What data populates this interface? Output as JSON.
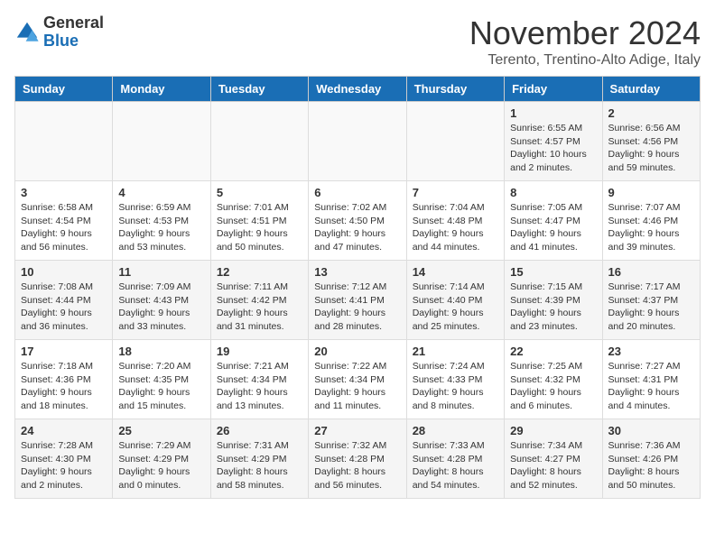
{
  "logo": {
    "general": "General",
    "blue": "Blue"
  },
  "title": "November 2024",
  "subtitle": "Terento, Trentino-Alto Adige, Italy",
  "headers": [
    "Sunday",
    "Monday",
    "Tuesday",
    "Wednesday",
    "Thursday",
    "Friday",
    "Saturday"
  ],
  "weeks": [
    [
      {
        "day": "",
        "info": ""
      },
      {
        "day": "",
        "info": ""
      },
      {
        "day": "",
        "info": ""
      },
      {
        "day": "",
        "info": ""
      },
      {
        "day": "",
        "info": ""
      },
      {
        "day": "1",
        "info": "Sunrise: 6:55 AM\nSunset: 4:57 PM\nDaylight: 10 hours and 2 minutes."
      },
      {
        "day": "2",
        "info": "Sunrise: 6:56 AM\nSunset: 4:56 PM\nDaylight: 9 hours and 59 minutes."
      }
    ],
    [
      {
        "day": "3",
        "info": "Sunrise: 6:58 AM\nSunset: 4:54 PM\nDaylight: 9 hours and 56 minutes."
      },
      {
        "day": "4",
        "info": "Sunrise: 6:59 AM\nSunset: 4:53 PM\nDaylight: 9 hours and 53 minutes."
      },
      {
        "day": "5",
        "info": "Sunrise: 7:01 AM\nSunset: 4:51 PM\nDaylight: 9 hours and 50 minutes."
      },
      {
        "day": "6",
        "info": "Sunrise: 7:02 AM\nSunset: 4:50 PM\nDaylight: 9 hours and 47 minutes."
      },
      {
        "day": "7",
        "info": "Sunrise: 7:04 AM\nSunset: 4:48 PM\nDaylight: 9 hours and 44 minutes."
      },
      {
        "day": "8",
        "info": "Sunrise: 7:05 AM\nSunset: 4:47 PM\nDaylight: 9 hours and 41 minutes."
      },
      {
        "day": "9",
        "info": "Sunrise: 7:07 AM\nSunset: 4:46 PM\nDaylight: 9 hours and 39 minutes."
      }
    ],
    [
      {
        "day": "10",
        "info": "Sunrise: 7:08 AM\nSunset: 4:44 PM\nDaylight: 9 hours and 36 minutes."
      },
      {
        "day": "11",
        "info": "Sunrise: 7:09 AM\nSunset: 4:43 PM\nDaylight: 9 hours and 33 minutes."
      },
      {
        "day": "12",
        "info": "Sunrise: 7:11 AM\nSunset: 4:42 PM\nDaylight: 9 hours and 31 minutes."
      },
      {
        "day": "13",
        "info": "Sunrise: 7:12 AM\nSunset: 4:41 PM\nDaylight: 9 hours and 28 minutes."
      },
      {
        "day": "14",
        "info": "Sunrise: 7:14 AM\nSunset: 4:40 PM\nDaylight: 9 hours and 25 minutes."
      },
      {
        "day": "15",
        "info": "Sunrise: 7:15 AM\nSunset: 4:39 PM\nDaylight: 9 hours and 23 minutes."
      },
      {
        "day": "16",
        "info": "Sunrise: 7:17 AM\nSunset: 4:37 PM\nDaylight: 9 hours and 20 minutes."
      }
    ],
    [
      {
        "day": "17",
        "info": "Sunrise: 7:18 AM\nSunset: 4:36 PM\nDaylight: 9 hours and 18 minutes."
      },
      {
        "day": "18",
        "info": "Sunrise: 7:20 AM\nSunset: 4:35 PM\nDaylight: 9 hours and 15 minutes."
      },
      {
        "day": "19",
        "info": "Sunrise: 7:21 AM\nSunset: 4:34 PM\nDaylight: 9 hours and 13 minutes."
      },
      {
        "day": "20",
        "info": "Sunrise: 7:22 AM\nSunset: 4:34 PM\nDaylight: 9 hours and 11 minutes."
      },
      {
        "day": "21",
        "info": "Sunrise: 7:24 AM\nSunset: 4:33 PM\nDaylight: 9 hours and 8 minutes."
      },
      {
        "day": "22",
        "info": "Sunrise: 7:25 AM\nSunset: 4:32 PM\nDaylight: 9 hours and 6 minutes."
      },
      {
        "day": "23",
        "info": "Sunrise: 7:27 AM\nSunset: 4:31 PM\nDaylight: 9 hours and 4 minutes."
      }
    ],
    [
      {
        "day": "24",
        "info": "Sunrise: 7:28 AM\nSunset: 4:30 PM\nDaylight: 9 hours and 2 minutes."
      },
      {
        "day": "25",
        "info": "Sunrise: 7:29 AM\nSunset: 4:29 PM\nDaylight: 9 hours and 0 minutes."
      },
      {
        "day": "26",
        "info": "Sunrise: 7:31 AM\nSunset: 4:29 PM\nDaylight: 8 hours and 58 minutes."
      },
      {
        "day": "27",
        "info": "Sunrise: 7:32 AM\nSunset: 4:28 PM\nDaylight: 8 hours and 56 minutes."
      },
      {
        "day": "28",
        "info": "Sunrise: 7:33 AM\nSunset: 4:28 PM\nDaylight: 8 hours and 54 minutes."
      },
      {
        "day": "29",
        "info": "Sunrise: 7:34 AM\nSunset: 4:27 PM\nDaylight: 8 hours and 52 minutes."
      },
      {
        "day": "30",
        "info": "Sunrise: 7:36 AM\nSunset: 4:26 PM\nDaylight: 8 hours and 50 minutes."
      }
    ]
  ]
}
